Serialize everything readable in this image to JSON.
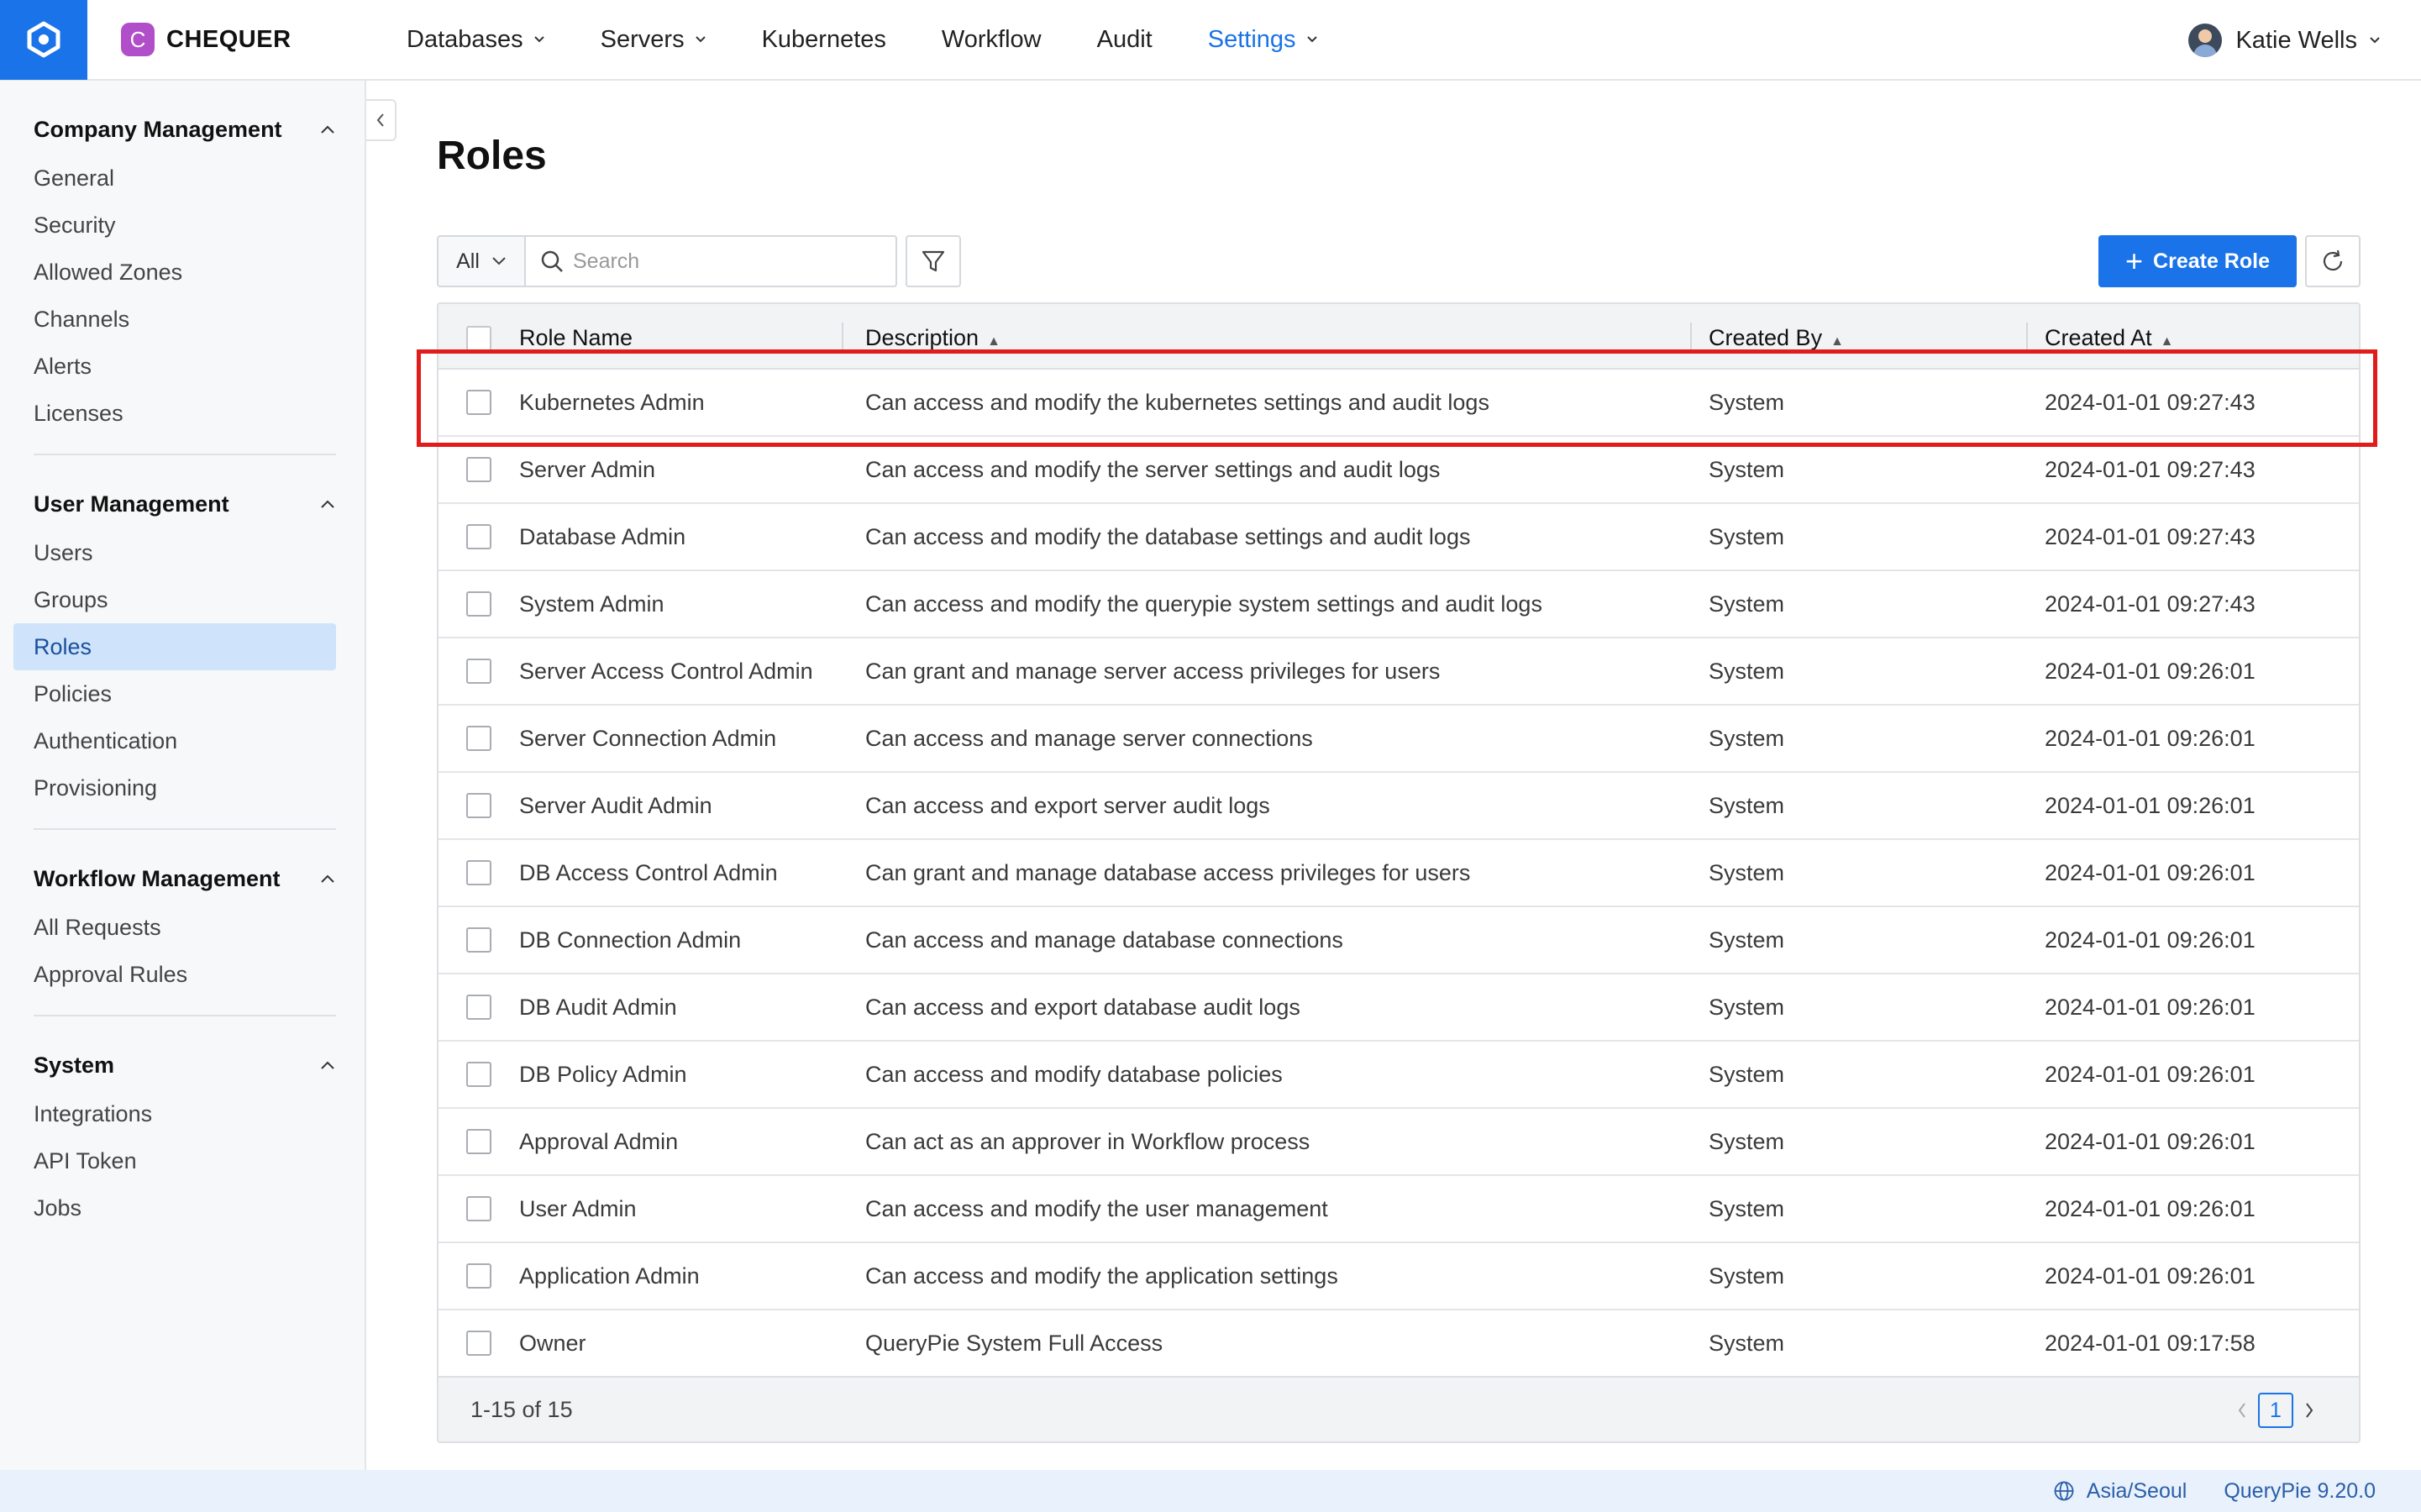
{
  "app": {
    "brand_initial": "C",
    "brand_name": "CHEQUER",
    "accent_color": "#1a73e8",
    "highlight_color": "#e21b1b"
  },
  "nav": {
    "items": [
      {
        "label": "Databases"
      },
      {
        "label": "Servers"
      },
      {
        "label": "Kubernetes"
      },
      {
        "label": "Workflow"
      },
      {
        "label": "Audit"
      },
      {
        "label": "Settings"
      }
    ],
    "active": "Settings"
  },
  "user": {
    "name": "Katie Wells"
  },
  "sidebar": {
    "sections": [
      {
        "title": "Company Management",
        "items": [
          "General",
          "Security",
          "Allowed Zones",
          "Channels",
          "Alerts",
          "Licenses"
        ]
      },
      {
        "title": "User Management",
        "items": [
          "Users",
          "Groups",
          "Roles",
          "Policies",
          "Authentication",
          "Provisioning"
        ]
      },
      {
        "title": "Workflow Management",
        "items": [
          "All Requests",
          "Approval Rules"
        ]
      },
      {
        "title": "System",
        "items": [
          "Integrations",
          "API Token",
          "Jobs"
        ]
      }
    ],
    "active_item": "Roles"
  },
  "page": {
    "title": "Roles"
  },
  "toolbar": {
    "scope_value": "All",
    "search_placeholder": "Search",
    "create_label": "Create Role"
  },
  "table": {
    "columns": [
      "Role Name",
      "Description",
      "Created By",
      "Created At"
    ],
    "rows": [
      {
        "name": "Kubernetes Admin",
        "description": "Can access and modify the kubernetes settings and audit logs",
        "created_by": "System",
        "created_at": "2024-01-01 09:27:43"
      },
      {
        "name": "Server Admin",
        "description": "Can access and modify the server settings and audit logs",
        "created_by": "System",
        "created_at": "2024-01-01 09:27:43"
      },
      {
        "name": "Database Admin",
        "description": "Can access and modify the database settings and audit logs",
        "created_by": "System",
        "created_at": "2024-01-01 09:27:43"
      },
      {
        "name": "System Admin",
        "description": "Can access and modify the querypie system settings and audit logs",
        "created_by": "System",
        "created_at": "2024-01-01 09:27:43"
      },
      {
        "name": "Server Access Control Admin",
        "description": "Can grant and manage server access privileges for users",
        "created_by": "System",
        "created_at": "2024-01-01 09:26:01"
      },
      {
        "name": "Server Connection Admin",
        "description": "Can access and manage server connections",
        "created_by": "System",
        "created_at": "2024-01-01 09:26:01"
      },
      {
        "name": "Server Audit Admin",
        "description": "Can access and export server audit logs",
        "created_by": "System",
        "created_at": "2024-01-01 09:26:01"
      },
      {
        "name": "DB Access Control Admin",
        "description": "Can grant and manage database access privileges for users",
        "created_by": "System",
        "created_at": "2024-01-01 09:26:01"
      },
      {
        "name": "DB Connection Admin",
        "description": "Can access and manage database connections",
        "created_by": "System",
        "created_at": "2024-01-01 09:26:01"
      },
      {
        "name": "DB Audit Admin",
        "description": "Can access and export database audit logs",
        "created_by": "System",
        "created_at": "2024-01-01 09:26:01"
      },
      {
        "name": "DB Policy Admin",
        "description": "Can access and modify database policies",
        "created_by": "System",
        "created_at": "2024-01-01 09:26:01"
      },
      {
        "name": "Approval Admin",
        "description": "Can act as an approver in Workflow process",
        "created_by": "System",
        "created_at": "2024-01-01 09:26:01"
      },
      {
        "name": "User Admin",
        "description": "Can access and modify the user management",
        "created_by": "System",
        "created_at": "2024-01-01 09:26:01"
      },
      {
        "name": "Application Admin",
        "description": "Can access and modify the application settings",
        "created_by": "System",
        "created_at": "2024-01-01 09:26:01"
      },
      {
        "name": "Owner",
        "description": "QueryPie System Full Access",
        "created_by": "System",
        "created_at": "2024-01-01 09:17:58"
      }
    ],
    "pagination_summary": "1-15 of 15",
    "current_page": "1"
  },
  "status": {
    "timezone": "Asia/Seoul",
    "version": "QueryPie 9.20.0"
  }
}
